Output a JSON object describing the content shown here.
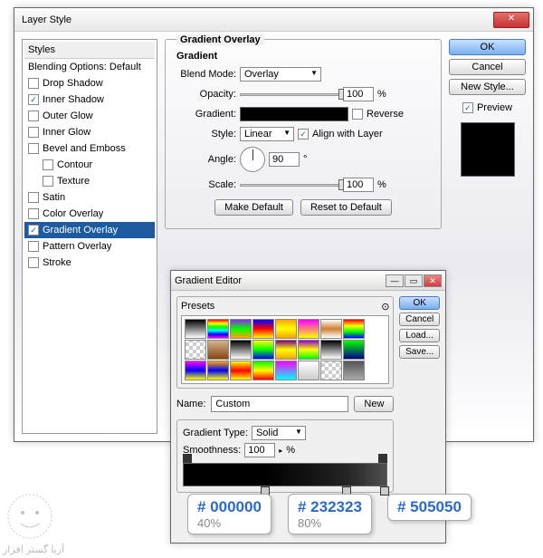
{
  "window": {
    "title": "Layer Style"
  },
  "styles": {
    "header": "Styles",
    "blending": "Blending Options: Default",
    "items": [
      {
        "label": "Drop Shadow",
        "checked": false,
        "indent": false
      },
      {
        "label": "Inner Shadow",
        "checked": true,
        "indent": false
      },
      {
        "label": "Outer Glow",
        "checked": false,
        "indent": false
      },
      {
        "label": "Inner Glow",
        "checked": false,
        "indent": false
      },
      {
        "label": "Bevel and Emboss",
        "checked": false,
        "indent": false
      },
      {
        "label": "Contour",
        "checked": false,
        "indent": true
      },
      {
        "label": "Texture",
        "checked": false,
        "indent": true
      },
      {
        "label": "Satin",
        "checked": false,
        "indent": false
      },
      {
        "label": "Color Overlay",
        "checked": false,
        "indent": false
      },
      {
        "label": "Gradient Overlay",
        "checked": true,
        "indent": false,
        "selected": true
      },
      {
        "label": "Pattern Overlay",
        "checked": false,
        "indent": false
      },
      {
        "label": "Stroke",
        "checked": false,
        "indent": false
      }
    ]
  },
  "overlay": {
    "group_title": "Gradient Overlay",
    "sub_title": "Gradient",
    "blend_label": "Blend Mode:",
    "blend_value": "Overlay",
    "opacity_label": "Opacity:",
    "opacity_value": "100",
    "opacity_unit": "%",
    "gradient_label": "Gradient:",
    "reverse_label": "Reverse",
    "style_label": "Style:",
    "style_value": "Linear",
    "align_label": "Align with Layer",
    "angle_label": "Angle:",
    "angle_value": "90",
    "angle_unit": "°",
    "scale_label": "Scale:",
    "scale_value": "100",
    "scale_unit": "%",
    "make_default": "Make Default",
    "reset_default": "Reset to Default"
  },
  "right": {
    "ok": "OK",
    "cancel": "Cancel",
    "new_style": "New Style...",
    "preview": "Preview"
  },
  "editor": {
    "title": "Gradient Editor",
    "presets_label": "Presets",
    "ok": "OK",
    "cancel": "Cancel",
    "load": "Load...",
    "save": "Save...",
    "name_label": "Name:",
    "name_value": "Custom",
    "new_btn": "New",
    "type_label": "Gradient Type:",
    "type_value": "Solid",
    "smooth_label": "Smoothness:",
    "smooth_value": "100",
    "smooth_unit": "%"
  },
  "callouts": [
    {
      "hex": "# 000000",
      "pct": "40%"
    },
    {
      "hex": "# 232323",
      "pct": "80%"
    },
    {
      "hex": "# 505050",
      "pct": ""
    }
  ],
  "gradient_stops": [
    {
      "color": "#000000",
      "position": 40
    },
    {
      "color": "#232323",
      "position": 80
    },
    {
      "color": "#505050",
      "position": 100
    }
  ],
  "watermark": "آریا گستر افزار"
}
